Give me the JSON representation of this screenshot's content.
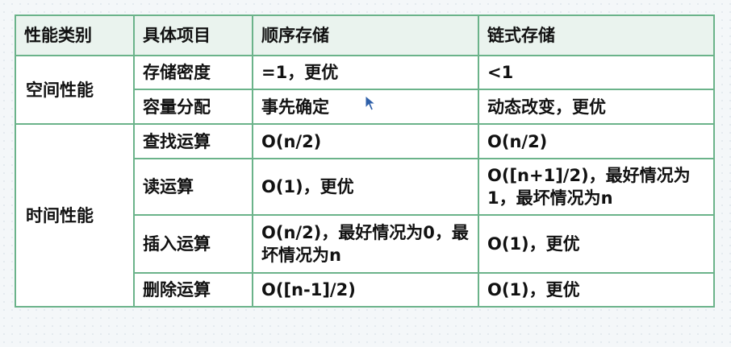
{
  "table": {
    "headers": [
      "性能类别",
      "具体项目",
      "顺序存储",
      "链式存储"
    ],
    "groups": {
      "space": "空间性能",
      "time": "时间性能"
    },
    "rows": [
      {
        "item": "存储密度",
        "seq": "=1，更优",
        "link": "<1"
      },
      {
        "item": "容量分配",
        "seq": "事先确定",
        "link": "动态改变，更优"
      },
      {
        "item": "查找运算",
        "seq": "O(n/2)",
        "link": "O(n/2)"
      },
      {
        "item": "读运算",
        "seq": "O(1)，更优",
        "link": "O([n+1]/2)，最好情况为1，最坏情况为n"
      },
      {
        "item": "插入运算",
        "seq": "O(n/2)，最好情况为0，最坏情况为n",
        "link": "O(1)，更优"
      },
      {
        "item": "删除运算",
        "seq": "O([n-1]/2)",
        "link": "O(1)，更优"
      }
    ]
  },
  "colors": {
    "border": "#6bb38a",
    "cursor": "#2e5fa8"
  },
  "icons": {
    "cursor": "mouse-pointer-icon"
  }
}
